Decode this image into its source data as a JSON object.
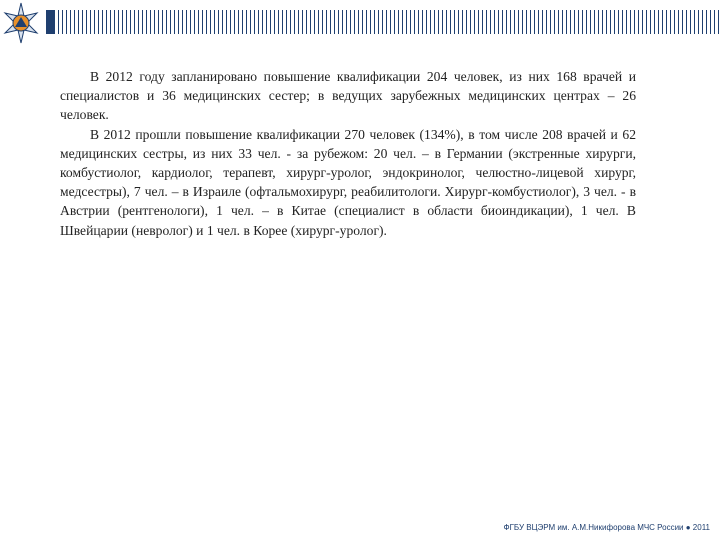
{
  "paragraphs": [
    "В 2012 году запланировано повышение квалификации 204 человек, из них 168 врачей и специалистов и 36 медицинских сестер; в ведущих зарубежных медицинских центрах – 26 человек.",
    "В 2012 прошли повышение квалификации 270 человек (134%), в том числе 208 врачей и 62 медицинских сестры, из них 33 чел. - за рубежом: 20 чел. – в Германии (экстренные хирурги, комбустиолог, кардиолог, терапевт, хирург-уролог, эндокринолог, челюстно-лицевой хирург, медсестры), 7 чел. – в Израиле (офтальмохирург, реабилитологи. Хирург-комбустиолог), 3 чел. - в Австрии (рентгенологи), 1 чел. – в Китае (специалист в области биоиндикации), 1 чел. В Швейцарии (невролог) и 1 чел. в Корее (хирург-уролог)."
  ],
  "footer": "ФГБУ ВЦЭРМ им. А.М.Никифорова МЧС России ● 2011",
  "icons": {
    "emblem": "emergency-ministry-emblem"
  },
  "colors": {
    "brand_blue": "#1f3f6f",
    "emblem_orange": "#e8902a",
    "text": "#222222",
    "background": "#ffffff"
  }
}
